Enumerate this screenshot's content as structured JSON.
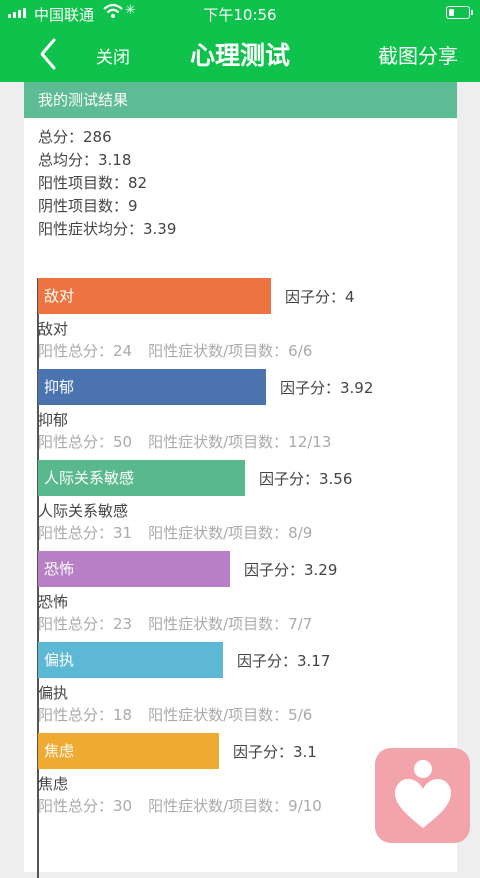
{
  "status": {
    "carrier": "中国联通",
    "time": "下午10:56"
  },
  "nav": {
    "close": "关闭",
    "title": "心理测试",
    "share": "截图分享"
  },
  "card": {
    "header": "我的测试结果",
    "summary": [
      "总分：286",
      "总均分：3.18",
      "阳性项目数：82",
      "阴性项目数：9",
      "阳性症状均分：3.39"
    ]
  },
  "chart_data": {
    "type": "bar",
    "orientation": "horizontal",
    "categories": [
      "敌对",
      "抑郁",
      "人际关系敏感",
      "恐怖",
      "偏执",
      "焦虑"
    ],
    "values": [
      4,
      3.92,
      3.56,
      3.29,
      3.17,
      3.1
    ],
    "colors": [
      "#ed7440",
      "#4a73b0",
      "#59b98d",
      "#b97fc6",
      "#5db8d6",
      "#efaa32"
    ],
    "score_prefix": "因子分：",
    "details": [
      {
        "total": "阳性总分：24",
        "ratio": "阳性症状数/项目数：6/6"
      },
      {
        "total": "阳性总分：50",
        "ratio": "阳性症状数/项目数：12/13"
      },
      {
        "total": "阳性总分：31",
        "ratio": "阳性症状数/项目数：8/9"
      },
      {
        "total": "阳性总分：23",
        "ratio": "阳性症状数/项目数：7/7"
      },
      {
        "total": "阳性总分：18",
        "ratio": "阳性症状数/项目数：5/6"
      },
      {
        "total": "阳性总分：30",
        "ratio": "阳性症状数/项目数：9/10"
      }
    ],
    "xlim": [
      0,
      5
    ]
  }
}
